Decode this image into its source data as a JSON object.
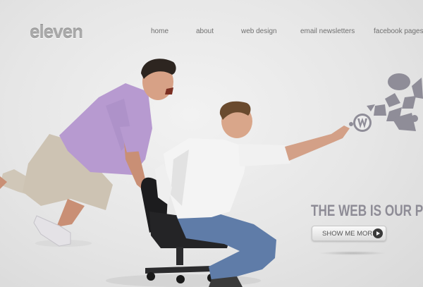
{
  "brand": {
    "logo_text": "eleven"
  },
  "nav": {
    "items": [
      {
        "label": "home"
      },
      {
        "label": "about"
      },
      {
        "label": "web design"
      },
      {
        "label": "email newsletters"
      },
      {
        "label": "facebook pages"
      }
    ]
  },
  "hero": {
    "heading": "THE WEB IS OUR P",
    "cta_label": "SHOW ME MORE"
  },
  "icons": [
    "wordpress-icon",
    "chevron-right-icon"
  ],
  "colors": {
    "background": "#e6e6e6",
    "logo": "#a9a9a9",
    "nav_text": "#707070",
    "heading": "#8e8c96",
    "icon_cloud": "#8f8d98",
    "shirt_left": "#b79ad0",
    "shirt_right": "#f4f4f4",
    "jeans": "#5f7ca8"
  }
}
